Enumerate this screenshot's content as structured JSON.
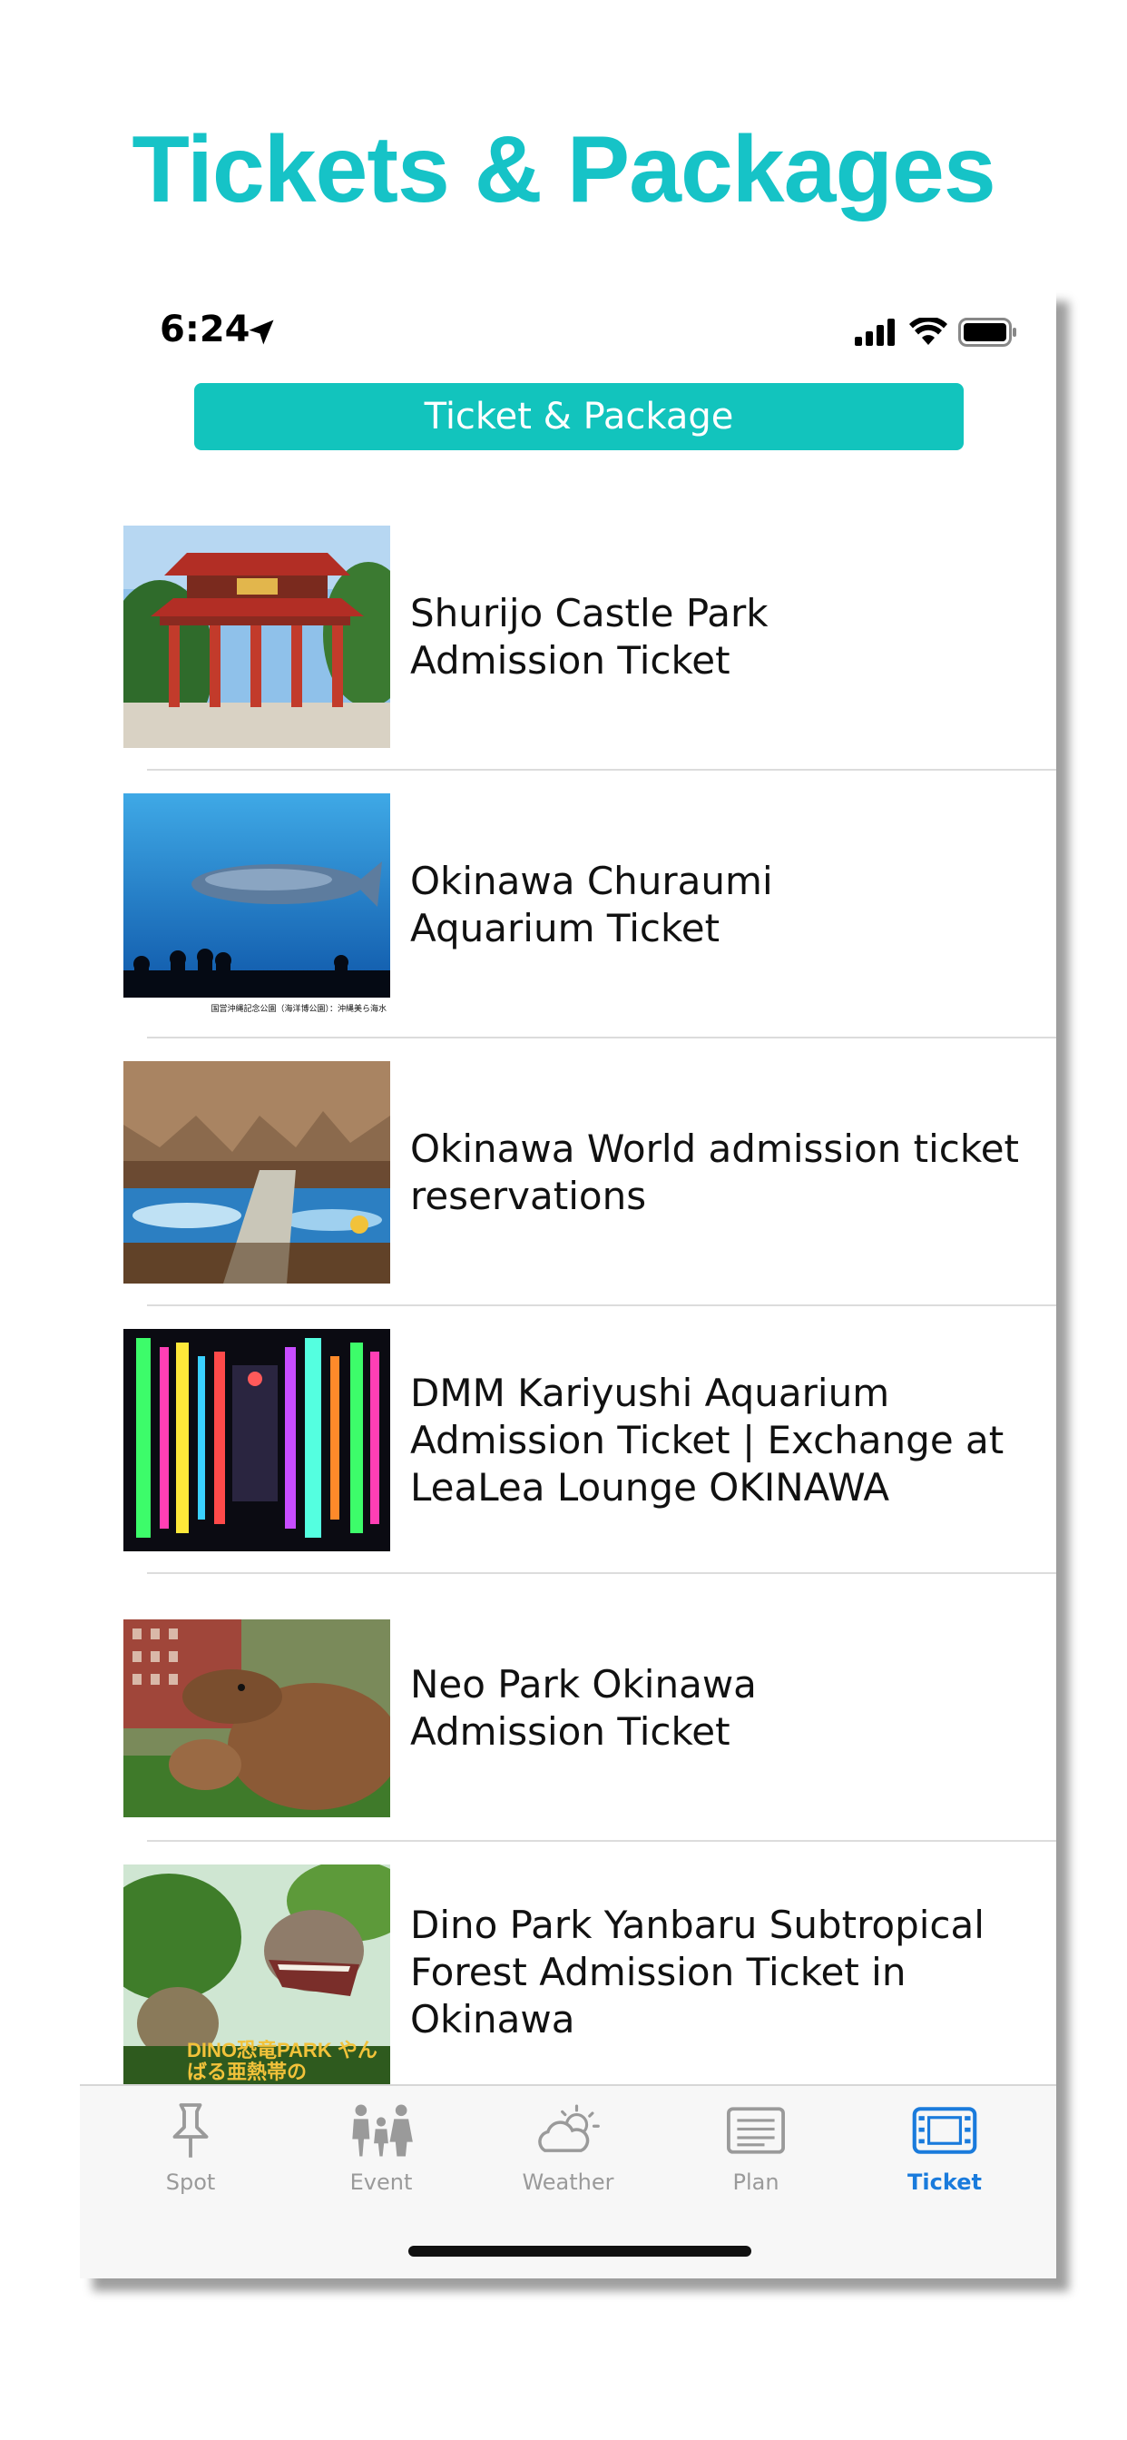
{
  "headline": "Tickets & Packages",
  "status_bar": {
    "time": "6:24"
  },
  "header": {
    "button_label": "Ticket & Package"
  },
  "tickets": [
    {
      "title": "Shurijo Castle Park\nAdmission Ticket"
    },
    {
      "title": "Okinawa Churaumi\nAquarium Ticket",
      "photo_caption": "国営沖縄記念公園（海洋博公園）：沖縄美ら海水"
    },
    {
      "title": "Okinawa World admission ticket\nreservations"
    },
    {
      "title": "DMM Kariyushi Aquarium\nAdmission Ticket | Exchange at\nLeaLea Lounge OKINAWA"
    },
    {
      "title": "Neo Park Okinawa\nAdmission Ticket"
    },
    {
      "title": "Dino Park Yanbaru Subtropical\nForest Admission Ticket in\nOkinawa",
      "photo_text": "DINO恐竜PARK やんばる亜熱帯の"
    }
  ],
  "tabs": [
    {
      "label": "Spot",
      "icon": "pushpin-icon"
    },
    {
      "label": "Event",
      "icon": "family-icon"
    },
    {
      "label": "Weather",
      "icon": "partly-cloudy-icon"
    },
    {
      "label": "Plan",
      "icon": "document-list-icon"
    },
    {
      "label": "Ticket",
      "icon": "film-ticket-icon",
      "active": true
    }
  ],
  "colors": {
    "accent": "#16c3c7",
    "header_button": "#12c4bd",
    "tab_active": "#1a7bdc",
    "tab_inactive": "#9a9a9a"
  }
}
